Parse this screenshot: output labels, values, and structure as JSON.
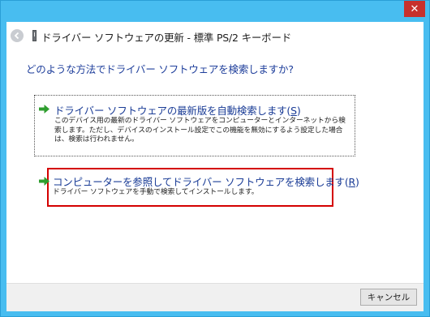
{
  "window": {
    "close_label": "✕"
  },
  "header": {
    "title": "ドライバー ソフトウェアの更新 - 標準 PS/2 キーボード"
  },
  "question": "どのような方法でドライバー ソフトウェアを検索しますか?",
  "options": [
    {
      "title": "ドライバー ソフトウェアの最新版を自動検索します(",
      "accel": "S",
      "title_end": ")",
      "description": "このデバイス用の最新のドライバー ソフトウェアをコンピューターとインターネットから検索します。ただし、デバイスのインストール設定でこの機能を無効にするよう設定した場合は、検索は行われません。"
    },
    {
      "title": "コンピューターを参照してドライバー ソフトウェアを検索します(",
      "accel": "R",
      "title_end": ")",
      "description": "ドライバー ソフトウェアを手動で検索してインストールします。"
    }
  ],
  "footer": {
    "cancel_label": "キャンセル"
  },
  "colors": {
    "window_frame": "#48bdf0",
    "close_button": "#c7312d",
    "link_text": "#1a3c96",
    "highlight_border": "#d40000",
    "arrow_green": "#2f9e2f"
  },
  "icons": {
    "back": "back-arrow-icon",
    "device": "keyboard-device-icon",
    "option_arrow": "green-arrow-icon"
  }
}
